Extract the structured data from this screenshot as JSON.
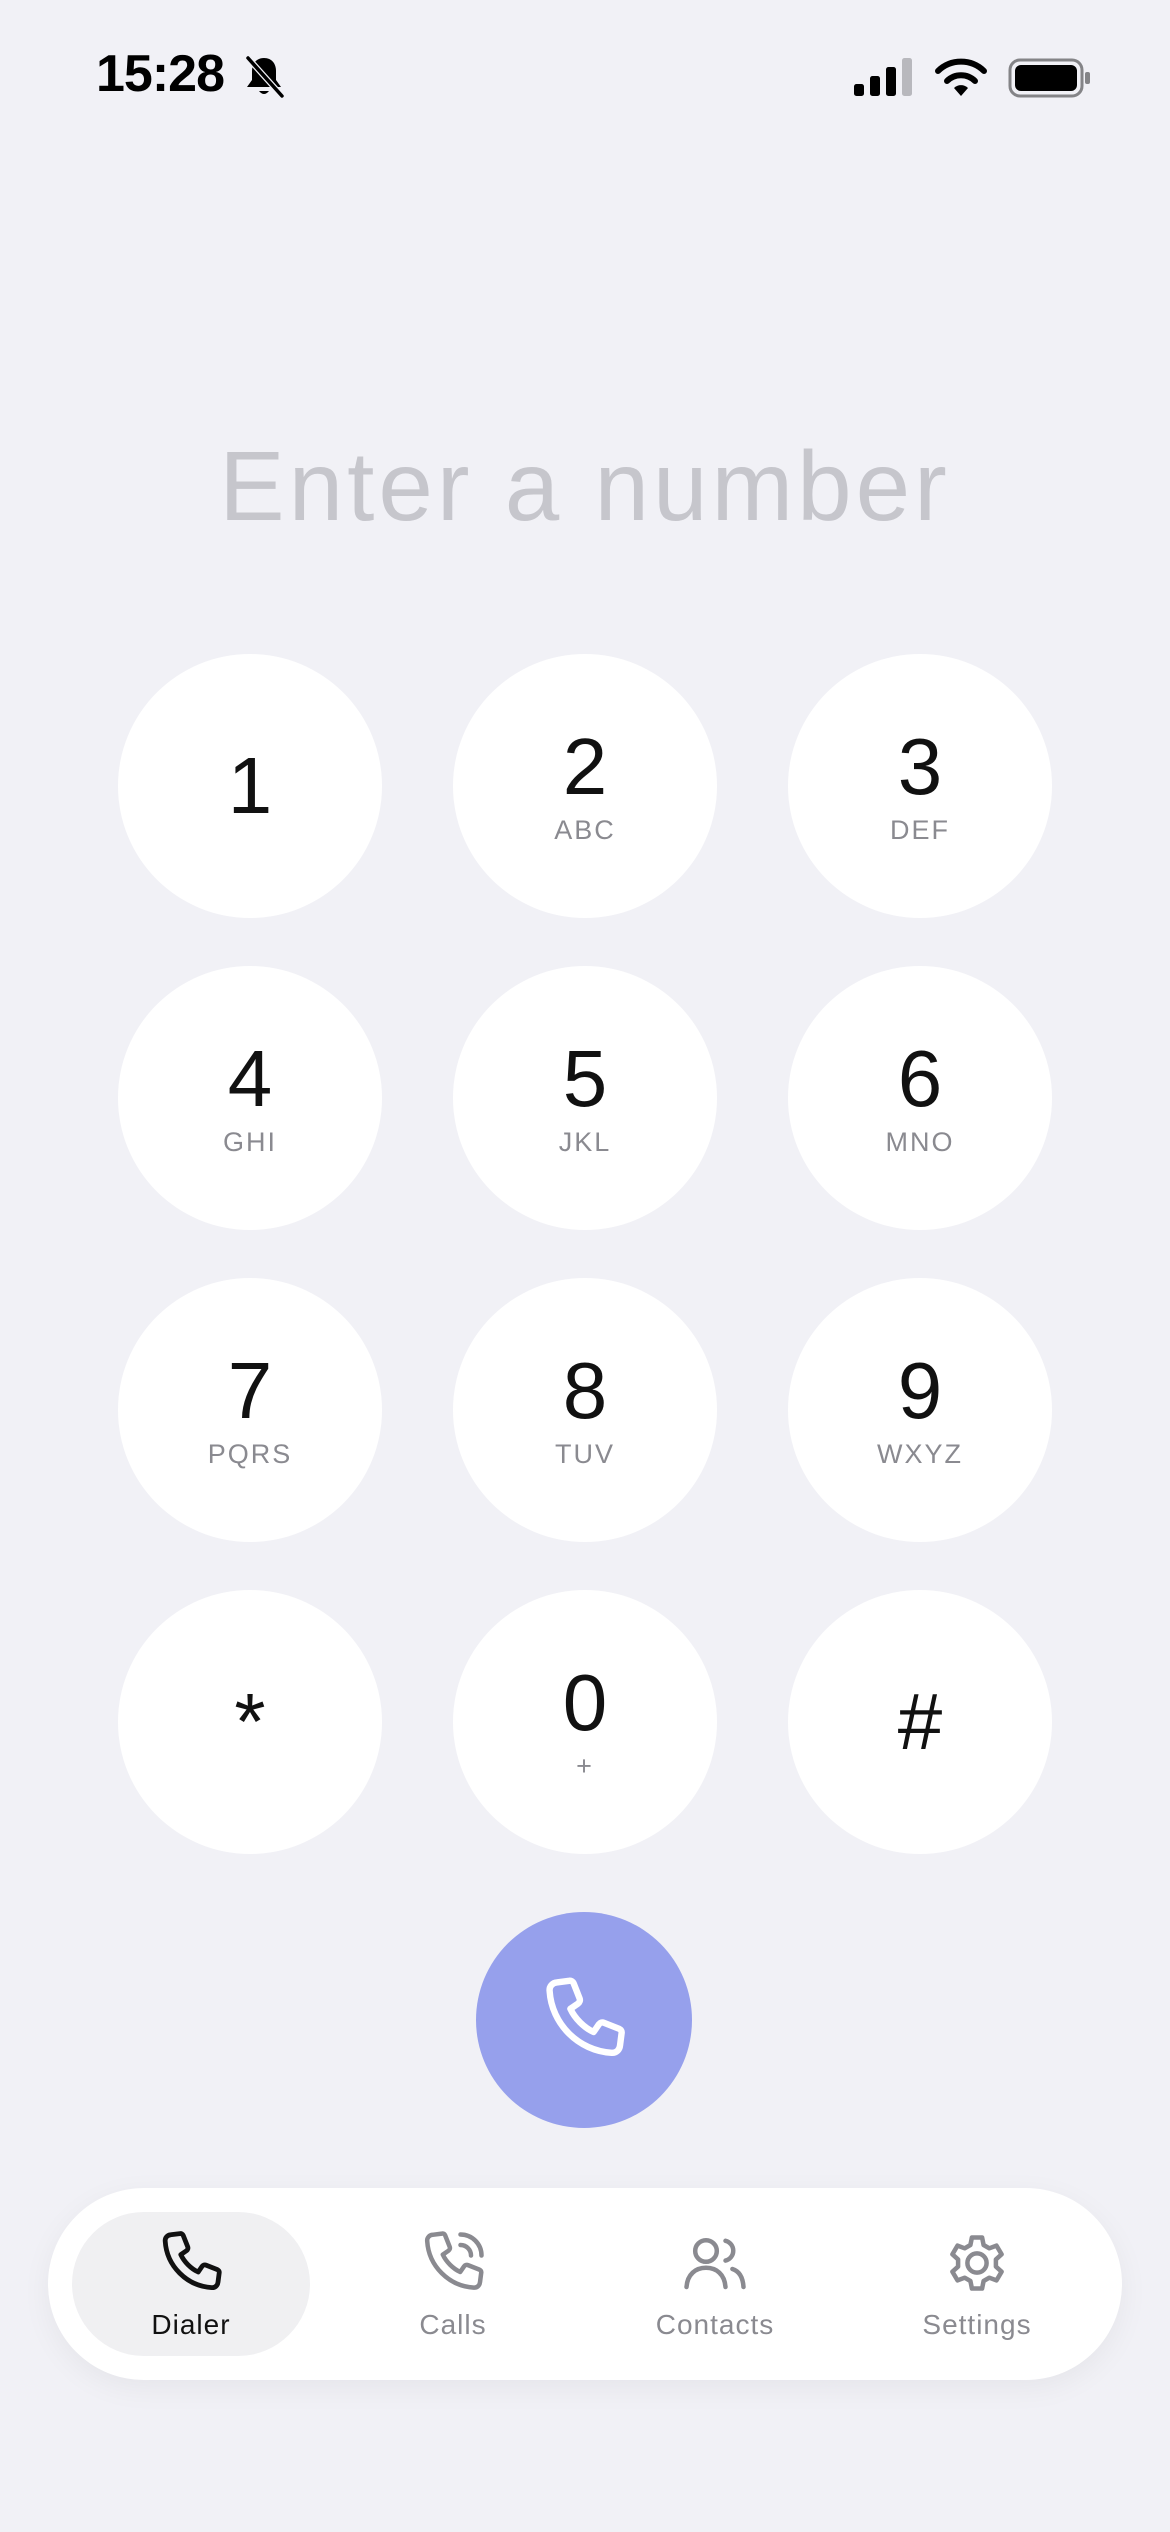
{
  "status_bar": {
    "time": "15:28",
    "icons": [
      "bell-slash-icon",
      "cellular-signal-icon",
      "wifi-icon",
      "battery-icon"
    ]
  },
  "dialer": {
    "placeholder": "Enter a number",
    "keys": [
      {
        "digit": "1",
        "letters": ""
      },
      {
        "digit": "2",
        "letters": "ABC"
      },
      {
        "digit": "3",
        "letters": "DEF"
      },
      {
        "digit": "4",
        "letters": "GHI"
      },
      {
        "digit": "5",
        "letters": "JKL"
      },
      {
        "digit": "6",
        "letters": "MNO"
      },
      {
        "digit": "7",
        "letters": "PQRS"
      },
      {
        "digit": "8",
        "letters": "TUV"
      },
      {
        "digit": "9",
        "letters": "WXYZ"
      },
      {
        "digit": "*",
        "letters": ""
      },
      {
        "digit": "0",
        "letters": "+"
      },
      {
        "digit": "#",
        "letters": ""
      }
    ],
    "call_icon": "phone-icon",
    "call_color": "#96a0ec"
  },
  "tabs": [
    {
      "label": "Dialer",
      "icon": "phone-icon",
      "active": true
    },
    {
      "label": "Calls",
      "icon": "phone-waves-icon",
      "active": false
    },
    {
      "label": "Contacts",
      "icon": "people-icon",
      "active": false
    },
    {
      "label": "Settings",
      "icon": "gear-icon",
      "active": false
    }
  ]
}
